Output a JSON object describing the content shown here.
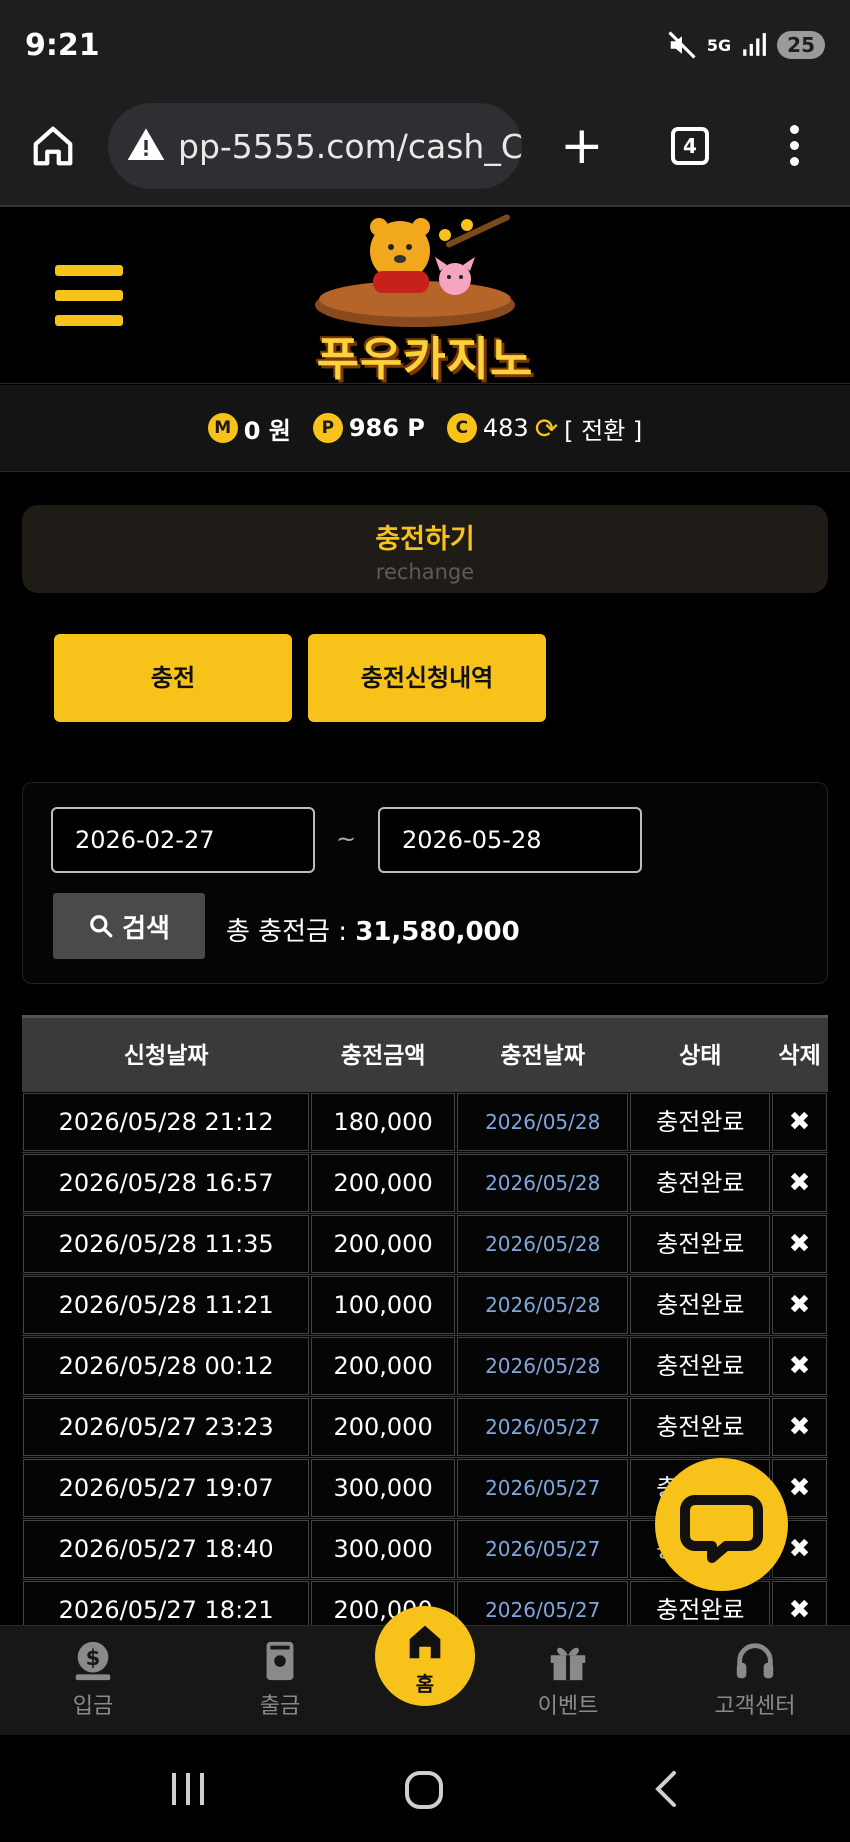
{
  "status_bar": {
    "time": "9:21",
    "network": "5G",
    "battery": "25"
  },
  "browser": {
    "url": "pp-5555.com/cash_C",
    "tab_count": "4"
  },
  "site": {
    "logo_text": "푸우카지노"
  },
  "balance": {
    "money_icon": "M",
    "money": "0 원",
    "point_icon": "P",
    "points": "986 P",
    "coin_icon": "C",
    "coins": "483",
    "convert_label": "[ 전환 ]"
  },
  "page": {
    "title": "충전하기",
    "subtitle": "rechange"
  },
  "tabs": [
    {
      "label": "충전"
    },
    {
      "label": "충전신청내역"
    }
  ],
  "search": {
    "date_from": "2026-02-27",
    "separator": "~",
    "date_to": "2026-05-28",
    "button_label": "검색",
    "total_label": "총 충전금 :",
    "total_value": "31,580,000"
  },
  "table": {
    "headers": [
      "신청날짜",
      "충전금액",
      "충전날짜",
      "상태",
      "삭제"
    ],
    "rows": [
      {
        "req": "2026/05/28 21:12",
        "amount": "180,000",
        "date": "2026/05/28",
        "status": "충전완료",
        "del": "✖"
      },
      {
        "req": "2026/05/28 16:57",
        "amount": "200,000",
        "date": "2026/05/28",
        "status": "충전완료",
        "del": "✖"
      },
      {
        "req": "2026/05/28 11:35",
        "amount": "200,000",
        "date": "2026/05/28",
        "status": "충전완료",
        "del": "✖"
      },
      {
        "req": "2026/05/28 11:21",
        "amount": "100,000",
        "date": "2026/05/28",
        "status": "충전완료",
        "del": "✖"
      },
      {
        "req": "2026/05/28 00:12",
        "amount": "200,000",
        "date": "2026/05/28",
        "status": "충전완료",
        "del": "✖"
      },
      {
        "req": "2026/05/27 23:23",
        "amount": "200,000",
        "date": "2026/05/27",
        "status": "충전완료",
        "del": "✖"
      },
      {
        "req": "2026/05/27 19:07",
        "amount": "300,000",
        "date": "2026/05/27",
        "status": "충전완료",
        "del": "✖"
      },
      {
        "req": "2026/05/27 18:40",
        "amount": "300,000",
        "date": "2026/05/27",
        "status": "충전완료",
        "del": "✖"
      },
      {
        "req": "2026/05/27 18:21",
        "amount": "200,000",
        "date": "2026/05/27",
        "status": "충전완료",
        "del": "✖"
      }
    ]
  },
  "bottom_nav": {
    "deposit": "입금",
    "withdraw": "출금",
    "home": "홈",
    "event": "이벤트",
    "support": "고객센터"
  },
  "colors": {
    "accent": "#f7c21a",
    "date_link": "#7fa7dd",
    "background": "#000000"
  }
}
